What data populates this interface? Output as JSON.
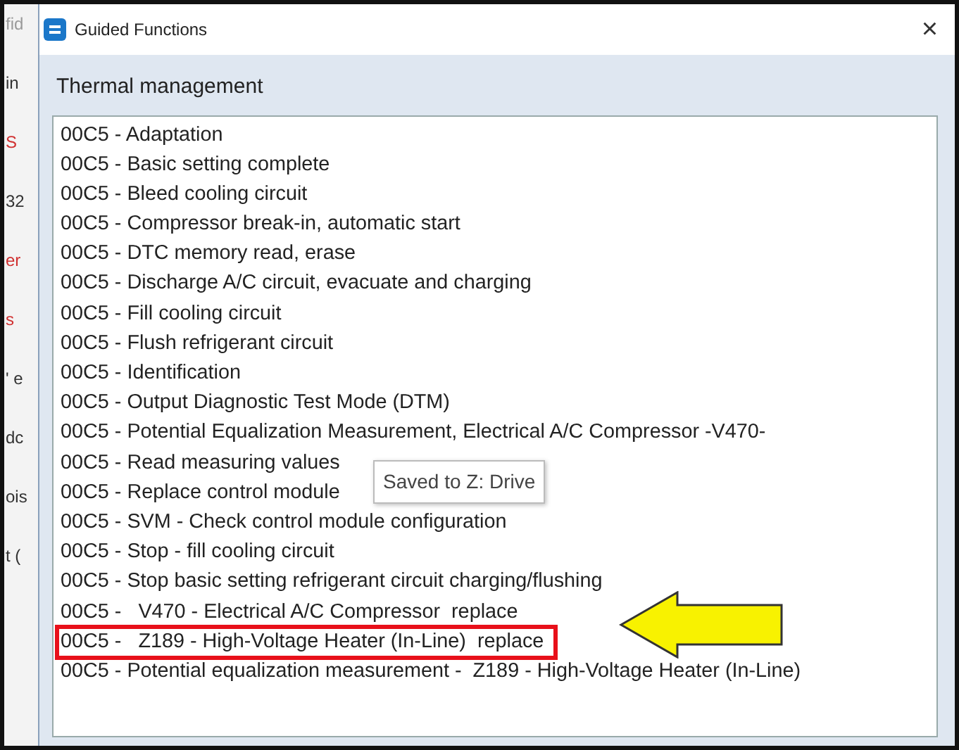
{
  "background_window": {
    "fragments": [
      {
        "text": "fid",
        "color": "#9a9a9a"
      },
      {
        "text": "in",
        "color": "#333333"
      },
      {
        "text": "S",
        "color": "#d03030"
      },
      {
        "text": "32",
        "color": "#333333"
      },
      {
        "text": "er",
        "color": "#d03030"
      },
      {
        "text": "s",
        "color": "#d03030"
      },
      {
        "text": "' e",
        "color": "#333333"
      },
      {
        "text": "dc",
        "color": "#333333"
      },
      {
        "text": "ois",
        "color": "#333333"
      },
      {
        "text": "t (",
        "color": "#333333"
      }
    ]
  },
  "window": {
    "title": "Guided Functions",
    "close": "×"
  },
  "heading": "Thermal management",
  "functions": [
    {
      "label": "00C5 - Adaptation",
      "highlighted": false
    },
    {
      "label": "00C5 - Basic setting complete",
      "highlighted": false
    },
    {
      "label": "00C5 - Bleed cooling circuit",
      "highlighted": false
    },
    {
      "label": "00C5 - Compressor break-in, automatic start",
      "highlighted": false
    },
    {
      "label": "00C5 - DTC memory read, erase",
      "highlighted": false
    },
    {
      "label": "00C5 - Discharge A/C circuit, evacuate and charging",
      "highlighted": false
    },
    {
      "label": "00C5 - Fill cooling circuit",
      "highlighted": false
    },
    {
      "label": "00C5 - Flush refrigerant circuit",
      "highlighted": false
    },
    {
      "label": "00C5 - Identification",
      "highlighted": false
    },
    {
      "label": "00C5 - Output Diagnostic Test Mode (DTM)",
      "highlighted": false
    },
    {
      "label": "00C5 - Potential Equalization Measurement, Electrical A/C Compressor -V470-",
      "highlighted": false
    },
    {
      "label": "00C5 - Read measuring values",
      "highlighted": false
    },
    {
      "label": "00C5 - Replace control module",
      "highlighted": false
    },
    {
      "label": "00C5 - SVM - Check control module configuration",
      "highlighted": false
    },
    {
      "label": "00C5 - Stop - fill cooling circuit",
      "highlighted": false
    },
    {
      "label": "00C5 - Stop basic setting refrigerant circuit charging/flushing",
      "highlighted": false
    },
    {
      "label": "00C5 -   V470 - Electrical A/C Compressor  replace",
      "highlighted": false
    },
    {
      "label": "00C5 -   Z189 - High-Voltage Heater (In-Line)  replace",
      "highlighted": true
    },
    {
      "label": "00C5 - Potential equalization measurement -  Z189 - High-Voltage Heater (In-Line)",
      "highlighted": false
    }
  ],
  "tooltip": "Saved to Z: Drive"
}
